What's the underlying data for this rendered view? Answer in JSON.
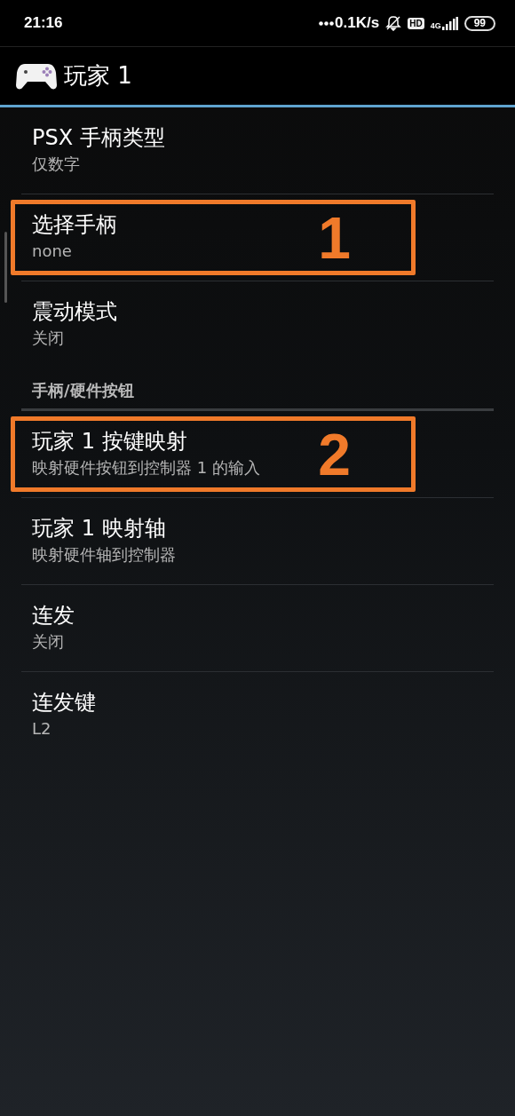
{
  "status_bar": {
    "time": "21:16",
    "net_speed": "0.1K/s",
    "hd_badge": "HD",
    "network": "4G",
    "battery": "99"
  },
  "app_bar": {
    "title": "玩家 1"
  },
  "rows": [
    {
      "kind": "setting",
      "title": "PSX 手柄类型",
      "summary": "仅数字"
    },
    {
      "kind": "setting",
      "title": "选择手柄",
      "summary": "none",
      "callout": "1"
    },
    {
      "kind": "setting",
      "title": "震动模式",
      "summary": "关闭"
    },
    {
      "kind": "category",
      "title": "手柄/硬件按钮"
    },
    {
      "kind": "setting",
      "title": "玩家 1 按键映射",
      "summary": "映射硬件按钮到控制器 1 的输入",
      "callout": "2"
    },
    {
      "kind": "setting",
      "title": "玩家 1 映射轴",
      "summary": "映射硬件轴到控制器"
    },
    {
      "kind": "setting",
      "title": "连发",
      "summary": "关闭"
    },
    {
      "kind": "setting",
      "title": "连发键",
      "summary": "L2"
    }
  ]
}
